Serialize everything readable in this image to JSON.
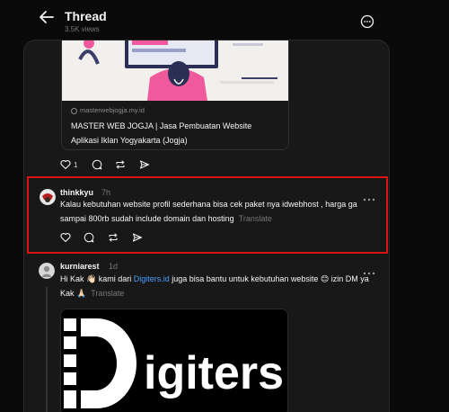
{
  "header": {
    "title": "Thread",
    "views": "3.5K views"
  },
  "previous_post": {
    "card": {
      "domain": "masterwebjogja.my.id",
      "title": "MASTER WEB JOGJA | Jasa Pembuatan Website Aplikasi Iklan Yogyakarta (Jogja)"
    },
    "like_count": "1"
  },
  "highlighted_post": {
    "username": "thinkkyu",
    "time": "7h",
    "text": "Kalau kebutuhan website profil sederhana bisa cek paket nya idwebhost , harga ga sampai 800rb sudah include domain dan hosting",
    "translate": "Translate"
  },
  "reply_post": {
    "username": "kurniarest",
    "time": "1d",
    "text_before": "Hi Kak 👋🏻 kami dari ",
    "link": "Digiters.id",
    "text_after": " juga bisa bantu untuk kebutuhan website 😊 izin DM ya Kak 🙏🏻",
    "translate": "Translate",
    "media_logo_text": "igiters"
  },
  "colors": {
    "highlight_border": "#d91414",
    "link": "#4a9cff",
    "background": "#0a0a0a",
    "panel": "#181818"
  }
}
